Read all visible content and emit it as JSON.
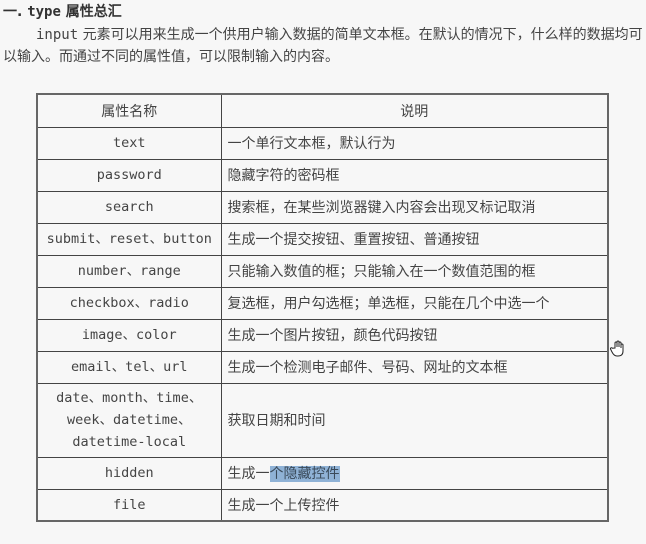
{
  "heading": {
    "prefix": "一. ",
    "code": "type",
    "title": " 属性总汇"
  },
  "intro": {
    "code": "input",
    "text": " 元素可以用来生成一个供用户输入数据的简单文本框。在默认的情况下，什么样的数据均可以输入。而通过不同的属性值，可以限制输入的内容。"
  },
  "table": {
    "headers": [
      "属性名称",
      "说明"
    ],
    "rows": [
      {
        "name": "text",
        "desc": "一个单行文本框，默认行为"
      },
      {
        "name": "password",
        "desc": "隐藏字符的密码框"
      },
      {
        "name": "search",
        "desc": "搜索框，在某些浏览器键入内容会出现叉标记取消"
      },
      {
        "name": "submit、reset、button",
        "desc": "生成一个提交按钮、重置按钮、普通按钮"
      },
      {
        "name": "number、range",
        "desc": "只能输入数值的框；只能输入在一个数值范围的框"
      },
      {
        "name": "checkbox、radio",
        "desc": "复选框，用户勾选框；单选框，只能在几个中选一个"
      },
      {
        "name": "image、color",
        "desc": "生成一个图片按钮，颜色代码按钮"
      },
      {
        "name": "email、tel、url",
        "desc": "生成一个检测电子邮件、号码、网址的文本框"
      },
      {
        "name_lines": [
          "date、month、time、",
          "week、datetime、",
          "datetime-local"
        ],
        "desc": "获取日期和时间"
      },
      {
        "name": "hidden",
        "desc_plain": "生成一",
        "desc_selected": "个隐藏控件"
      },
      {
        "name": "file",
        "desc": "生成一个上传控件"
      }
    ]
  },
  "cursor": {
    "icon": "hand-pointer-icon"
  },
  "colors": {
    "selection": "#8fb2d6",
    "border": "#444444",
    "background": "#f7f7f7"
  }
}
